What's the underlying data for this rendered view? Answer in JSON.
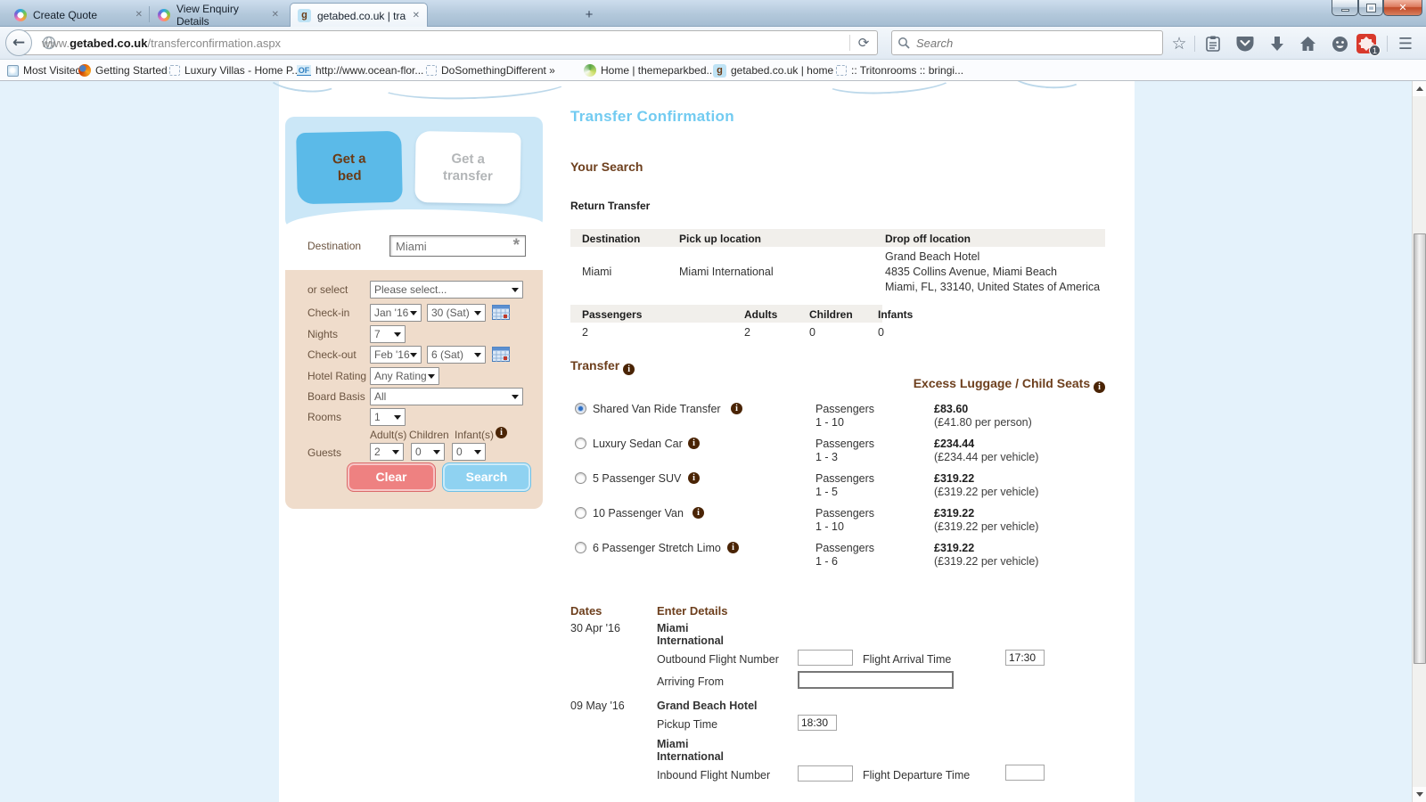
{
  "icons": {
    "close": "✕",
    "plus": "+",
    "back": "←",
    "reload": "⟳",
    "star": "☆",
    "menu": "☰",
    "info": "i",
    "asterisk": "*"
  },
  "browser": {
    "tabs": [
      {
        "label": "Create Quote"
      },
      {
        "label": "View Enquiry Details"
      },
      {
        "label": "getabed.co.uk | transferco...",
        "favicon_text": "g"
      }
    ],
    "navigation": {
      "url_prefix": "www.",
      "url_domain": "getabed.co.uk",
      "url_path": "/transferconfirmation.aspx",
      "search_placeholder": "Search",
      "adblock_badge": "1"
    },
    "bookmarks": {
      "items": [
        {
          "label": "Most Visited"
        },
        {
          "label": "Getting Started"
        },
        {
          "label": "Luxury Villas - Home P..."
        },
        {
          "label": "http://www.ocean-flor...",
          "icon_text": "OF"
        },
        {
          "label": "DoSomethingDifferent »"
        },
        {
          "label": "Home | themeparkbed..."
        },
        {
          "label": "getabed.co.uk | home",
          "icon_text": "g"
        },
        {
          "label": ":: Tritonrooms :: bringi..."
        }
      ]
    }
  },
  "sidebar": {
    "tabs": [
      {
        "line1": "Get a",
        "line2": "bed"
      },
      {
        "line1": "Get a",
        "line2": "transfer"
      }
    ],
    "destination_label": "Destination",
    "destination_value": "Miami",
    "or_select_label": "or select",
    "or_select_value": "Please select...",
    "checkin_label": "Check-in",
    "checkin_month": "Jan '16",
    "checkin_day": "30 (Sat)",
    "nights_label": "Nights",
    "nights_value": "7",
    "checkout_label": "Check-out",
    "checkout_month": "Feb '16",
    "checkout_day": "6 (Sat)",
    "hotel_rating_label": "Hotel Rating",
    "hotel_rating_value": "Any Rating",
    "board_basis_label": "Board Basis",
    "board_basis_value": "All",
    "rooms_label": "Rooms",
    "rooms_value": "1",
    "adults_label": "Adult(s)",
    "children_label": "Children",
    "infants_label": "Infant(s)",
    "guests_label": "Guests",
    "adults_value": "2",
    "children_value": "0",
    "infants_value": "0",
    "clear_button": "Clear",
    "search_button": "Search"
  },
  "main": {
    "page_title": "Transfer Confirmation",
    "your_search_title": "Your Search",
    "return_transfer_label": "Return Transfer",
    "location_table": {
      "headers": [
        "Destination",
        "Pick up location",
        "Drop off location"
      ],
      "destination": "Miami",
      "pickup": "Miami International",
      "dropoff_line1": "Grand Beach Hotel",
      "dropoff_line2": "4835 Collins Avenue, Miami Beach",
      "dropoff_line3": "Miami, FL, 33140, United States of America"
    },
    "passenger_table": {
      "headers": [
        "Passengers",
        "Adults",
        "Children",
        "Infants"
      ],
      "values": [
        "2",
        "2",
        "0",
        "0"
      ]
    },
    "transfer": {
      "title": "Transfer",
      "excess_title": "Excess Luggage / Child Seats",
      "passengers_word": "Passengers",
      "options": [
        {
          "label": "Shared Van Ride Transfer",
          "range": "1 - 10",
          "price": "£83.60",
          "note": "(£41.80 per person)"
        },
        {
          "label": "Luxury Sedan Car",
          "range": "1 - 3",
          "price": "£234.44",
          "note": "(£234.44 per vehicle)"
        },
        {
          "label": "5 Passenger SUV",
          "range": "1 - 5",
          "price": "£319.22",
          "note": "(£319.22 per vehicle)"
        },
        {
          "label": "10 Passenger Van",
          "range": "1 - 10",
          "price": "£319.22",
          "note": "(£319.22 per vehicle)"
        },
        {
          "label": "6 Passenger Stretch Limo",
          "range": "1 - 6",
          "price": "£319.22",
          "note": "(£319.22 per vehicle)"
        }
      ]
    },
    "details": {
      "dates_title": "Dates",
      "enter_details_title": "Enter Details",
      "outbound": {
        "date": "30 Apr '16",
        "location_line1": "Miami",
        "location_line2": "International",
        "flight_label": "Outbound Flight Number",
        "arrival_label": "Flight Arrival Time",
        "arrival_value": "17:30",
        "arriving_from_label": "Arriving From"
      },
      "inbound": {
        "date": "09 May '16",
        "hotel": "Grand Beach Hotel",
        "pickup_label": "Pickup Time",
        "pickup_value": "18:30",
        "location_line1": "Miami",
        "location_line2": "International",
        "flight_label": "Inbound Flight Number",
        "departure_label": "Flight Departure Time"
      }
    }
  },
  "colors": {
    "brand_blue": "#72cbf1",
    "brown": "#6d3f1d",
    "panel_blue": "#cbe7f7",
    "panel_tan": "#efdccb",
    "button_red": "#ee8181",
    "button_blue": "#8fd2f1",
    "info_icon": "#4a2405"
  }
}
